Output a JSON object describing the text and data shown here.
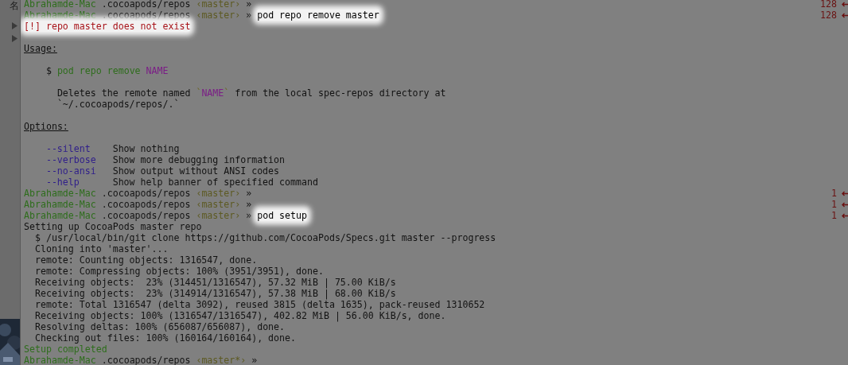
{
  "sidebar": {
    "label": "名"
  },
  "lines": [
    {
      "segments": [
        {
          "kind": "host",
          "text": "Abrahamde-Mac"
        },
        {
          "kind": "path",
          "text": " .cocoapods/repos"
        },
        {
          "kind": "branch",
          "text": " ‹master›"
        },
        {
          "kind": "path",
          "text": " »"
        }
      ],
      "status": "128"
    },
    {
      "segments": [
        {
          "kind": "host",
          "text": "Abrahamde-Mac"
        },
        {
          "kind": "path",
          "text": " .cocoapods/repos"
        },
        {
          "kind": "branch",
          "text": " ‹master›"
        },
        {
          "kind": "path",
          "text": " »"
        },
        {
          "kind": "cmd",
          "text": "pod repo remove master"
        }
      ],
      "status": "128"
    },
    {
      "segments": [
        {
          "kind": "error",
          "text": "[!] repo master does not exist"
        }
      ]
    },
    {
      "after_blank": true,
      "segments": [
        {
          "kind": "heading",
          "text": "Usage:"
        }
      ]
    },
    {
      "after_blank": true,
      "segments": [
        {
          "kind": "out",
          "text": "    $ "
        },
        {
          "kind": "green",
          "text": "pod repo remove"
        },
        {
          "kind": "purple",
          "text": " NAME"
        }
      ]
    },
    {
      "after_blank": true,
      "segments": [
        {
          "kind": "out",
          "text": "      Deletes the remote named "
        },
        {
          "kind": "tick",
          "text": "`"
        },
        {
          "kind": "purple",
          "text": "NAME"
        },
        {
          "kind": "tick",
          "text": "`"
        },
        {
          "kind": "out",
          "text": " from the local spec-repos directory at"
        }
      ]
    },
    {
      "segments": [
        {
          "kind": "out",
          "text": "      `~/.cocoapods/repos/.`"
        }
      ]
    },
    {
      "after_blank": true,
      "segments": [
        {
          "kind": "heading",
          "text": "Options:"
        }
      ]
    },
    {
      "after_blank": true,
      "segments": [
        {
          "kind": "flag",
          "text": "--silent"
        },
        {
          "kind": "out",
          "text": "Show nothing"
        }
      ]
    },
    {
      "segments": [
        {
          "kind": "flag",
          "text": "--verbose"
        },
        {
          "kind": "out",
          "text": "Show more debugging information"
        }
      ]
    },
    {
      "segments": [
        {
          "kind": "flag",
          "text": "--no-ansi"
        },
        {
          "kind": "out",
          "text": "Show output without ANSI codes"
        }
      ]
    },
    {
      "segments": [
        {
          "kind": "flag",
          "text": "--help"
        },
        {
          "kind": "out",
          "text": "Show help banner of specified command"
        }
      ]
    },
    {
      "segments": [
        {
          "kind": "host",
          "text": "Abrahamde-Mac"
        },
        {
          "kind": "path",
          "text": " .cocoapods/repos"
        },
        {
          "kind": "branch",
          "text": " ‹master›"
        },
        {
          "kind": "path",
          "text": " »"
        }
      ],
      "status": "1"
    },
    {
      "segments": [
        {
          "kind": "host",
          "text": "Abrahamde-Mac"
        },
        {
          "kind": "path",
          "text": " .cocoapods/repos"
        },
        {
          "kind": "branch",
          "text": " ‹master›"
        },
        {
          "kind": "path",
          "text": " »"
        }
      ],
      "status": "1"
    },
    {
      "segments": [
        {
          "kind": "host",
          "text": "Abrahamde-Mac"
        },
        {
          "kind": "path",
          "text": " .cocoapods/repos"
        },
        {
          "kind": "branch",
          "text": " ‹master›"
        },
        {
          "kind": "path",
          "text": " »"
        },
        {
          "kind": "cmd",
          "text": "pod setup"
        }
      ],
      "status": "1"
    },
    {
      "segments": [
        {
          "kind": "out",
          "text": "Setting up CocoaPods master repo"
        }
      ]
    },
    {
      "segments": [
        {
          "kind": "out",
          "text": "  $ /usr/local/bin/git clone https://github.com/CocoaPods/Specs.git master --progress"
        }
      ]
    },
    {
      "segments": [
        {
          "kind": "out",
          "text": "  Cloning into 'master'..."
        }
      ]
    },
    {
      "segments": [
        {
          "kind": "out",
          "text": "  remote: Counting objects: 1316547, done."
        }
      ]
    },
    {
      "segments": [
        {
          "kind": "out",
          "text": "  remote: Compressing objects: 100% (3951/3951), done."
        }
      ]
    },
    {
      "segments": [
        {
          "kind": "out",
          "text": "  Receiving objects:  23% (314451/1316547), 57.32 MiB | 75.00 KiB/s"
        }
      ]
    },
    {
      "segments": [
        {
          "kind": "out",
          "text": "  Receiving objects:  23% (314914/1316547), 57.38 MiB | 68.00 KiB/s"
        }
      ]
    },
    {
      "segments": [
        {
          "kind": "out",
          "text": "  remote: Total 1316547 (delta 3092), reused 3815 (delta 1635), pack-reused 1310652"
        }
      ]
    },
    {
      "segments": [
        {
          "kind": "out",
          "text": "  Receiving objects: 100% (1316547/1316547), 402.82 MiB | 56.00 KiB/s, done."
        }
      ]
    },
    {
      "segments": [
        {
          "kind": "out",
          "text": "  Resolving deltas: 100% (656087/656087), done."
        }
      ]
    },
    {
      "segments": [
        {
          "kind": "out",
          "text": "  Checking out files: 100% (160164/160164), done."
        }
      ]
    },
    {
      "segments": [
        {
          "kind": "host",
          "text": "Setup completed"
        }
      ]
    },
    {
      "segments": [
        {
          "kind": "host",
          "text": "Abrahamde-Mac"
        },
        {
          "kind": "path",
          "text": " .cocoapods/repos"
        },
        {
          "kind": "branch",
          "text": " ‹master*›"
        },
        {
          "kind": "path",
          "text": " »"
        }
      ]
    }
  ]
}
